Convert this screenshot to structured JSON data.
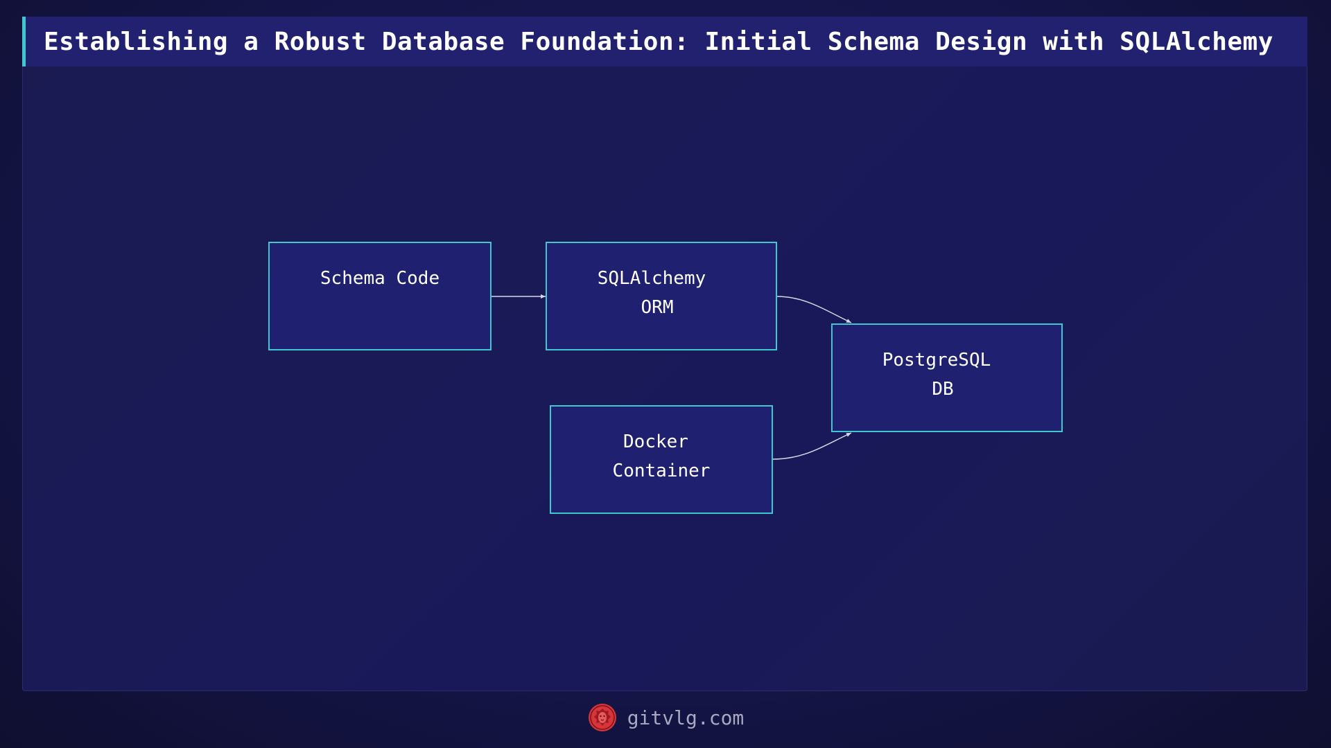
{
  "title": "Establishing a Robust Database Foundation: Initial Schema Design with SQLAlchemy",
  "diagram": {
    "nodes": {
      "schema_code": {
        "lines": [
          "Schema Code"
        ]
      },
      "sqlalchemy_orm": {
        "lines": [
          "SQLAlchemy",
          "ORM"
        ]
      },
      "postgresql_db": {
        "lines": [
          "PostgreSQL",
          "DB"
        ]
      },
      "docker_container": {
        "lines": [
          "Docker",
          "Container"
        ]
      }
    },
    "edges": [
      {
        "from": "Schema Code",
        "to": "SQLAlchemy ORM"
      },
      {
        "from": "SQLAlchemy ORM",
        "to": "PostgreSQL DB"
      },
      {
        "from": "Docker Container",
        "to": "PostgreSQL DB"
      }
    ]
  },
  "footer": {
    "site": "gitvlg.com",
    "logo_icon": "lion-head-icon"
  },
  "colors": {
    "background": "#15154a",
    "node_fill": "#202070",
    "node_border": "#3fc8cf",
    "title_accent": "#3fc8cf",
    "logo": "#d8353a"
  }
}
